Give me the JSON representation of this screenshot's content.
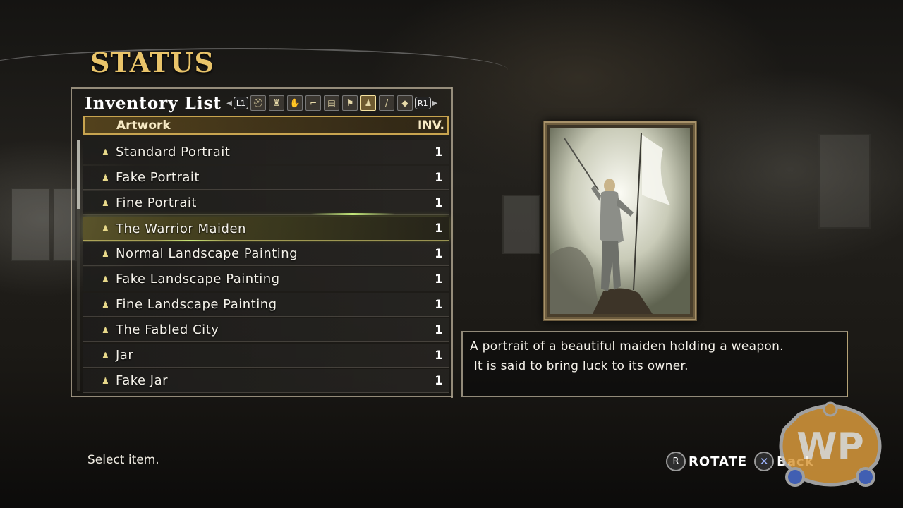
{
  "screen_title": "STATUS",
  "inventory": {
    "title": "Inventory List",
    "left_shoulder": "L1",
    "right_shoulder": "R1",
    "category_icons": [
      {
        "name": "helmet-icon",
        "glyph": "⛑",
        "active": false
      },
      {
        "name": "armor-icon",
        "glyph": "♜",
        "active": false
      },
      {
        "name": "gauntlet-icon",
        "glyph": "✋",
        "active": false
      },
      {
        "name": "boots-icon",
        "glyph": "⌐",
        "active": false
      },
      {
        "name": "book-icon",
        "glyph": "▤",
        "active": false
      },
      {
        "name": "flag-icon",
        "glyph": "⚑",
        "active": false
      },
      {
        "name": "bag-icon",
        "glyph": "♟",
        "active": true
      },
      {
        "name": "sword-icon",
        "glyph": "/",
        "active": false
      },
      {
        "name": "shield-icon",
        "glyph": "◆",
        "active": false
      }
    ]
  },
  "columns": {
    "name": "Artwork",
    "qty": "INV."
  },
  "items": [
    {
      "name": "Standard Portrait",
      "qty": "1"
    },
    {
      "name": "Fake Portrait",
      "qty": "1"
    },
    {
      "name": "Fine Portrait",
      "qty": "1"
    },
    {
      "name": "The Warrior Maiden",
      "qty": "1"
    },
    {
      "name": "Normal Landscape Painting",
      "qty": "1"
    },
    {
      "name": "Fake Landscape Painting",
      "qty": "1"
    },
    {
      "name": "Fine Landscape Painting",
      "qty": "1"
    },
    {
      "name": "The Fabled City",
      "qty": "1"
    },
    {
      "name": "Jar",
      "qty": "1"
    },
    {
      "name": "Fake Jar",
      "qty": "1"
    }
  ],
  "selected_index": 3,
  "description": {
    "line1": "A portrait of a beautiful maiden holding a weapon.",
    "line2": " It is said to bring luck to its owner."
  },
  "footer": {
    "hint": "Select item.",
    "rotate_button": "R",
    "rotate_label": "ROTATE",
    "back_button": "✕",
    "back_label": "Back"
  },
  "watermark": {
    "text": "WP"
  },
  "colors": {
    "title_gold": "#e9c46a",
    "selected_highlight": "#c8c850",
    "frame": "#6d5c3e"
  }
}
